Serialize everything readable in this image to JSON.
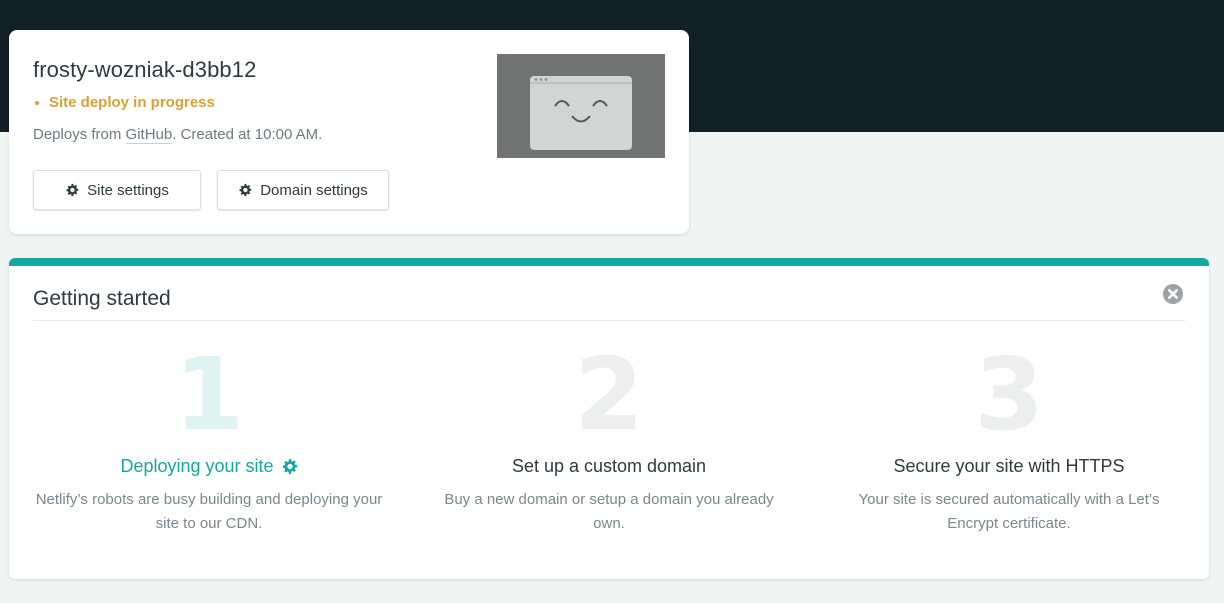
{
  "site": {
    "name": "frosty-wozniak-d3bb12",
    "status": "Site deploy in progress",
    "deploy_prefix": "Deploys from ",
    "repo": "GitHub",
    "deploy_suffix": ". Created at 10:00 AM.",
    "buttons": {
      "site_settings": "Site settings",
      "domain_settings": "Domain settings"
    },
    "preview_icon": "smiling-browser-window-icon"
  },
  "getting_started": {
    "title": "Getting started",
    "close_icon": "close-icon",
    "steps": [
      {
        "number": "1",
        "title": "Deploying your site",
        "icon": "gear-icon",
        "description": "Netlify’s robots are busy building and deploying your site to our CDN."
      },
      {
        "number": "2",
        "title": "Set up a custom domain",
        "description": "Buy a new domain or setup a domain you already own."
      },
      {
        "number": "3",
        "title": "Secure your site with HTTPS",
        "description": "Your site is secured automatically with a Let’s Encrypt certificate."
      }
    ]
  },
  "colors": {
    "header_bg": "#111f26",
    "accent_teal": "#16a79e",
    "status_yellow": "#d8a235",
    "page_bg": "#f0f5f4"
  }
}
